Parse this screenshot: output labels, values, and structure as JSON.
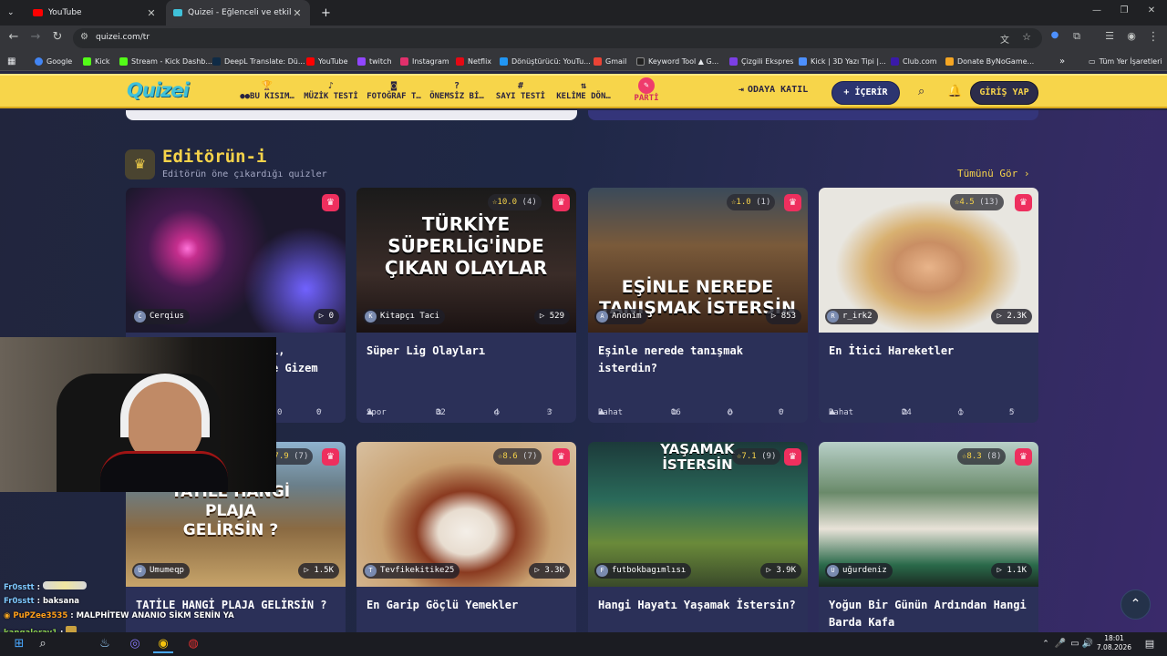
{
  "browser": {
    "tabs": [
      {
        "title": "YouTube",
        "active": false
      },
      {
        "title": "Quizei - Eğlenceli ve etkileşimli",
        "active": true
      }
    ],
    "new_tab": "+",
    "url": "quizei.com/tr",
    "window_controls": [
      "—",
      "❐",
      "✕"
    ],
    "bookmarks": [
      {
        "label": "Google",
        "color": "#4285f4"
      },
      {
        "label": "Kick",
        "color": "#53fc18"
      },
      {
        "label": "Stream - Kick Dashb...",
        "color": "#53fc18"
      },
      {
        "label": "DeepL Translate: Dü...",
        "color": "#0f2b46"
      },
      {
        "label": "YouTube",
        "color": "#ff0000"
      },
      {
        "label": "twitch",
        "color": "#9146ff"
      },
      {
        "label": "Instagram",
        "color": "#e1306c"
      },
      {
        "label": "Netflix",
        "color": "#e50914"
      },
      {
        "label": "Dönüştürücü: YouTu...",
        "color": "#2196f3"
      },
      {
        "label": "Gmail",
        "color": "#ea4335"
      },
      {
        "label": "Keyword Tool ▲ G...",
        "color": "#222222"
      },
      {
        "label": "Çizgili Ekspres",
        "color": "#7b3fe4"
      },
      {
        "label": "Kick | 3D Yazı Tipi |...",
        "color": "#4d90fe"
      },
      {
        "label": "Club.com",
        "color": "#3a1aa8"
      },
      {
        "label": "Donate ByNoGame...",
        "color": "#f5a623"
      }
    ],
    "bookmarks_overflow": "»",
    "all_bookmarks": "Tüm Yer İşaretleri"
  },
  "site": {
    "logo": "Quizei",
    "nav": [
      {
        "label": "●●BU KISIM…",
        "icon": "🏆"
      },
      {
        "label": "MÜZİK TESTİ",
        "icon": "♪"
      },
      {
        "label": "FOTOĞRAF T…",
        "icon": "📷"
      },
      {
        "label": "ÖNEMSİZ Bİ…",
        "icon": "?"
      },
      {
        "label": "SAYI TESTİ",
        "icon": "#"
      },
      {
        "label": "KELİME DÖN…",
        "icon": "⇅"
      },
      {
        "label": "PARTİ",
        "icon": "✎"
      }
    ],
    "join_room": "ODAYA KATIL",
    "create": "+ İÇERİR",
    "login": "GİRİŞ YAP"
  },
  "section": {
    "title": "Editörün-i",
    "subtitle": "Editörün öne çıkardığı quizler",
    "see_all": "Tümünü Gör ›"
  },
  "cards": [
    {
      "rating": "",
      "count": "",
      "author": "Cerqius",
      "avatar": "C",
      "plays": "0",
      "title": "",
      "category": "",
      "questions": "",
      "comments": "0",
      "likes": "0"
    },
    {
      "rating": "10.0",
      "count": "(4)",
      "author": "Kitapçı Taci",
      "avatar": "K",
      "plays": "529",
      "title": "Süper Lig Olayları",
      "category": "Spor",
      "questions": "32",
      "comments": "4",
      "likes": "3",
      "thumb_text": "TÜRKİYE SÜPERLİG'İNDE ÇIKAN OLAYLAR"
    },
    {
      "rating": "1.0",
      "count": "(1)",
      "author": "Anonim",
      "avatar": "A",
      "plays": "853",
      "title": "Eşinle nerede tanışmak isterdin?",
      "category": "Rahat",
      "questions": "16",
      "comments": "0",
      "likes": "0",
      "thumb_text": "EŞİNLE NEREDE TANIŞMAK İSTERSİN"
    },
    {
      "rating": "4.5",
      "count": "(13)",
      "author": "r_irk2",
      "avatar": "R",
      "plays": "2.3K",
      "title": "En İtici Hareketler",
      "category": "Rahat",
      "questions": "24",
      "comments": "1",
      "likes": "5"
    },
    {
      "rating": "7.9",
      "count": "(7)",
      "author": "Umumeqp",
      "avatar": "U",
      "plays": "1.5K",
      "title": "TATİLE HANGİ PLAJA GELİRSİN ?",
      "thumb_text": "TATİLE HANGİ PLAJA GELİRSİN ?"
    },
    {
      "rating": "8.6",
      "count": "(7)",
      "author": "Tevfikekitike25",
      "avatar": "T",
      "plays": "3.3K",
      "title": "En Garip Göçlü Yemekler"
    },
    {
      "rating": "7.1",
      "count": "(9)",
      "author": "futbokbagımlısı",
      "avatar": "F",
      "plays": "3.9K",
      "title": "Hangi Hayatı Yaşamak İstersin?",
      "thumb_text": "YAŞAMAK İSTERSİN"
    },
    {
      "rating": "8.3",
      "count": "(8)",
      "author": "uğurdeniz",
      "avatar": "U",
      "plays": "1.1K",
      "title": "Yoğun Bir Günün Ardından Hangi Barda Kafa"
    }
  ],
  "card1_partial_title": [
    "i,",
    "e Gizem"
  ],
  "chat": [
    {
      "user": "Fr0sstt",
      "msg": "",
      "color": "#7ec8ff"
    },
    {
      "user": "Fr0sstt",
      "msg": "baksana",
      "color": "#7ec8ff"
    },
    {
      "user": "PuPZee3535",
      "msg": "MALPHİTEW ANANIO SİKM SENİN YA",
      "color": "#ff9f1a"
    },
    {
      "user": "kangaleray1",
      "msg": "",
      "color": "#8fd14f"
    }
  ],
  "taskbar": {
    "time": "18:01",
    "date": "7.08.2026"
  }
}
